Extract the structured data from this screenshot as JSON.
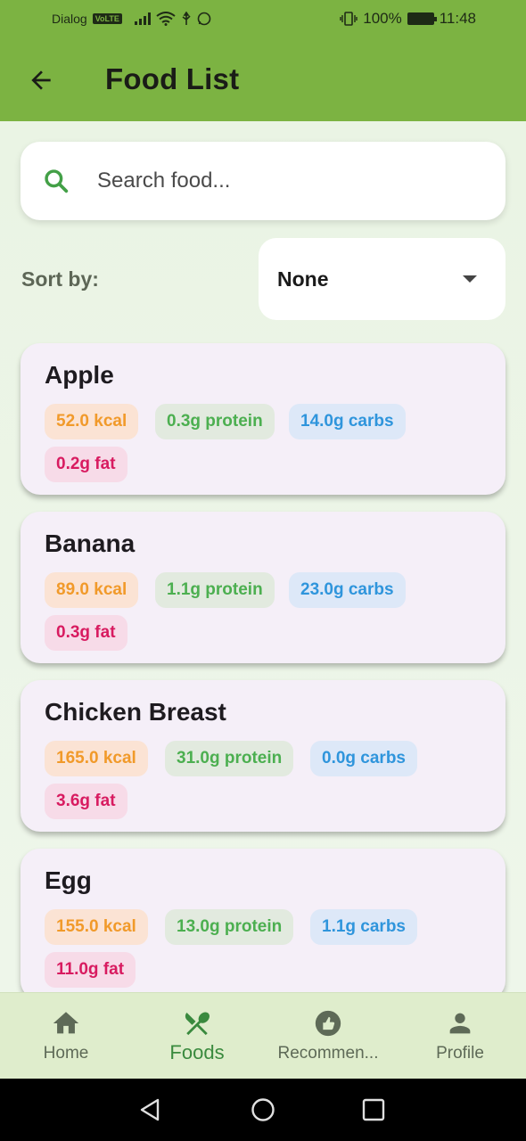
{
  "status_bar": {
    "carrier": "Dialog",
    "volte": "VoLTE",
    "battery": "100%",
    "time": "11:48"
  },
  "app_bar": {
    "title": "Food List",
    "back_icon": "arrow-back-icon"
  },
  "search": {
    "placeholder": "Search food...",
    "value": "",
    "icon": "search-icon"
  },
  "sort": {
    "label": "Sort by:",
    "selected": "None"
  },
  "foods": [
    {
      "name": "Apple",
      "kcal": "52.0 kcal",
      "protein": "0.3g protein",
      "carbs": "14.0g carbs",
      "fat": "0.2g fat"
    },
    {
      "name": "Banana",
      "kcal": "89.0 kcal",
      "protein": "1.1g protein",
      "carbs": "23.0g carbs",
      "fat": "0.3g fat"
    },
    {
      "name": "Chicken Breast",
      "kcal": "165.0 kcal",
      "protein": "31.0g protein",
      "carbs": "0.0g carbs",
      "fat": "3.6g fat"
    },
    {
      "name": "Egg",
      "kcal": "155.0 kcal",
      "protein": "13.0g protein",
      "carbs": "1.1g carbs",
      "fat": "11.0g fat"
    }
  ],
  "bottom_nav": [
    {
      "label": "Home",
      "icon": "home-icon",
      "active": false
    },
    {
      "label": "Foods",
      "icon": "restaurant-icon",
      "active": true
    },
    {
      "label": "Recommen...",
      "icon": "thumb-up-icon",
      "active": false
    },
    {
      "label": "Profile",
      "icon": "person-icon",
      "active": false
    }
  ],
  "colors": {
    "primary_green": "#7cb342",
    "active_nav": "#3a8a3e",
    "kcal": "#f19a2a",
    "protein": "#4caf50",
    "carbs": "#2f95dc",
    "fat": "#d81b60"
  }
}
